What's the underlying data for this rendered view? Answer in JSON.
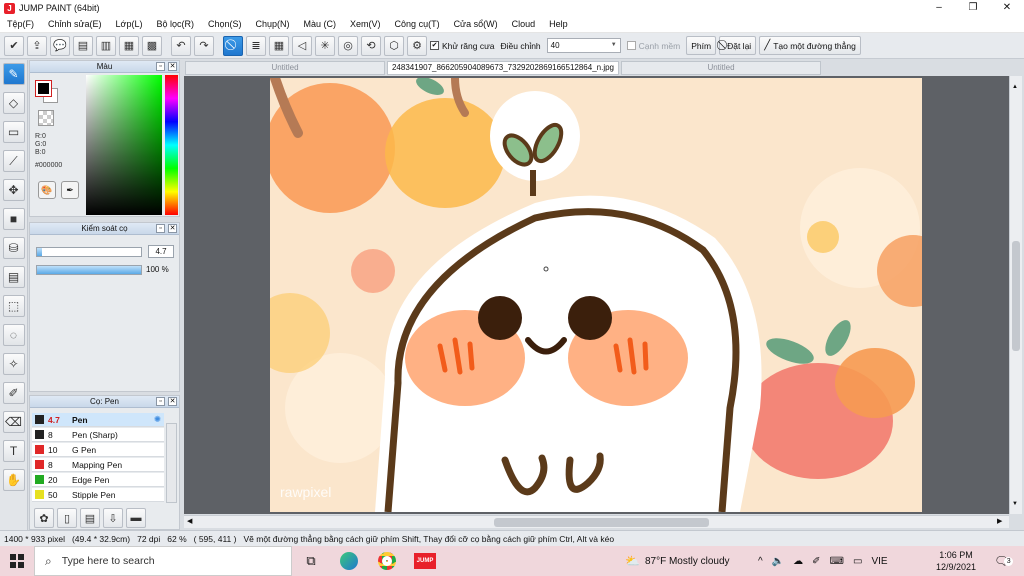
{
  "window": {
    "title": "JUMP PAINT (64bit)",
    "app_icon": "J",
    "min": "–",
    "max": "❐",
    "close": "✕"
  },
  "menu": [
    "Tệp(F)",
    "Chỉnh sửa(E)",
    "Lớp(L)",
    "Bộ lọc(R)",
    "Chọn(S)",
    "Chụp(N)",
    "Màu (C)",
    "Xem(V)",
    "Công cụ(T)",
    "Cửa sổ(W)",
    "Cloud",
    "Help"
  ],
  "toolbar": {
    "antialias_label": "Khử răng cưa",
    "adjust_label": "Điều chỉnh",
    "adjust_value": "40",
    "edge_label": "Cạnh mềm",
    "key_label": "Phím",
    "reset_label": "Đặt lại",
    "straight_label": "Tạo một đường thẳng"
  },
  "color_panel": {
    "title": "Màu",
    "r": "R:0",
    "g": "G:0",
    "b": "B:0",
    "hex": "#000000",
    "fg": "#000000",
    "bg": "#ffffff"
  },
  "brush_ctrl": {
    "title": "Kiểm soát cọ",
    "size_value": "4.7",
    "size_fraction": 0.05,
    "opacity_value": "100 %",
    "opacity_fraction": 1.0
  },
  "brush_list": {
    "title": "Cọ: Pen",
    "items": [
      {
        "size": "4.7",
        "name": "Pen",
        "color": "#222222"
      },
      {
        "size": "8",
        "name": "Pen (Sharp)",
        "color": "#222222"
      },
      {
        "size": "10",
        "name": "G Pen",
        "color": "#e02828"
      },
      {
        "size": "8",
        "name": "Mapping Pen",
        "color": "#e02828"
      },
      {
        "size": "20",
        "name": "Edge Pen",
        "color": "#22aa22"
      },
      {
        "size": "50",
        "name": "Stipple Pen",
        "color": "#e6e020"
      }
    ]
  },
  "tabs": [
    "Untitled",
    "248341907_866205904089673_7329202869166512864_n.jpg",
    "Untitled"
  ],
  "canvas": {
    "watermark": "rawpixel"
  },
  "status": {
    "size": "1400 * 933 pixel",
    "dims": "(49.4 * 32.9cm)",
    "dpi": "72 dpi",
    "zoom": "62 %",
    "coords": "( 595, 411 )",
    "hint": "Vẽ một đường thẳng bằng cách giữ phím Shift, Thay đổi cỡ cọ bằng cách giữ phím Ctrl, Alt và kéo"
  },
  "taskbar": {
    "search_placeholder": "Type here to search",
    "weather": "87°F  Mostly cloudy",
    "lang": "VIE",
    "time": "1:06 PM",
    "date": "12/9/2021",
    "notif": "3"
  }
}
